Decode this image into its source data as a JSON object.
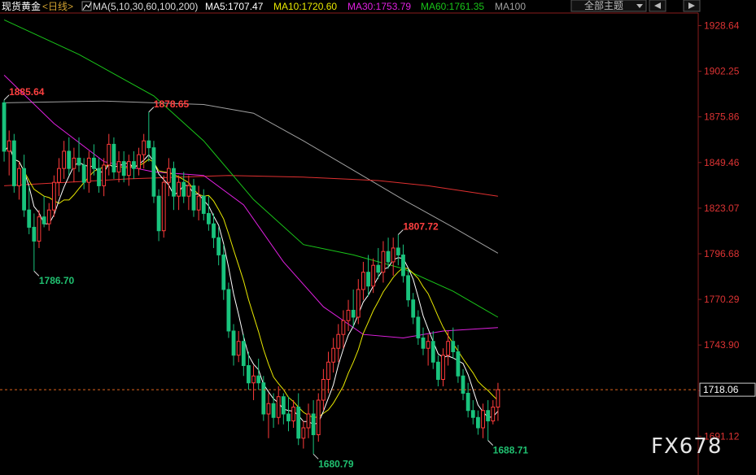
{
  "header": {
    "symbol": "现货黄金",
    "period": "<日线>",
    "ma_params": "MA(5,10,30,60,100,200)",
    "ma5": "MA5:1707.47",
    "ma10": "MA10:1720.60",
    "ma30": "MA30:1753.79",
    "ma60": "MA60:1761.35",
    "ma100": "MA100",
    "theme_button": "全部主题",
    "prev_icon": "prev-arrow-icon",
    "next_icon": "next-arrow-icon"
  },
  "watermark": "FX678",
  "colors": {
    "up": "#ff3b3b",
    "down": "#19c37d",
    "ma5": "#ffffff",
    "ma10": "#e8e800",
    "ma30": "#e020e0",
    "ma60": "#19c519",
    "ma100": "#a0a0a0",
    "ma200": "#e03030",
    "axis_text": "#d33333",
    "current_line": "#e0661e"
  },
  "chart_data": {
    "type": "candlestick",
    "ylim": [
      1680,
      1935
    ],
    "y_ticks": [
      "1928.64",
      "1902.25",
      "1875.86",
      "1849.46",
      "1823.07",
      "1796.68",
      "1770.29",
      "1743.90",
      "1717.51",
      "1691.12"
    ],
    "current_price": "1718.06",
    "annotations": [
      {
        "label": "1885.64",
        "value": 1885.64,
        "bar": 0,
        "kind": "high"
      },
      {
        "label": "1786.70",
        "value": 1786.7,
        "bar": 6,
        "kind": "low"
      },
      {
        "label": "1878.65",
        "value": 1878.65,
        "bar": 29,
        "kind": "high"
      },
      {
        "label": "1680.79",
        "value": 1680.79,
        "bar": 62,
        "kind": "low"
      },
      {
        "label": "1807.72",
        "value": 1807.72,
        "bar": 79,
        "kind": "high"
      },
      {
        "label": "1688.71",
        "value": 1688.71,
        "bar": 97,
        "kind": "low"
      }
    ],
    "candles_ohlc": [
      [
        1884,
        1885.64,
        1850,
        1856
      ],
      [
        1856,
        1868,
        1842,
        1862
      ],
      [
        1862,
        1866,
        1832,
        1836
      ],
      [
        1836,
        1850,
        1828,
        1846
      ],
      [
        1846,
        1854,
        1818,
        1822
      ],
      [
        1822,
        1836,
        1808,
        1812
      ],
      [
        1812,
        1820,
        1786.7,
        1804
      ],
      [
        1804,
        1822,
        1800,
        1818
      ],
      [
        1818,
        1830,
        1812,
        1814
      ],
      [
        1814,
        1826,
        1810,
        1822
      ],
      [
        1822,
        1842,
        1818,
        1838
      ],
      [
        1838,
        1852,
        1830,
        1846
      ],
      [
        1846,
        1862,
        1840,
        1856
      ],
      [
        1856,
        1864,
        1842,
        1846
      ],
      [
        1846,
        1858,
        1838,
        1852
      ],
      [
        1852,
        1864,
        1844,
        1848
      ],
      [
        1848,
        1852,
        1834,
        1838
      ],
      [
        1838,
        1856,
        1832,
        1852
      ],
      [
        1852,
        1860,
        1842,
        1846
      ],
      [
        1846,
        1852,
        1832,
        1836
      ],
      [
        1836,
        1852,
        1830,
        1848
      ],
      [
        1848,
        1866,
        1842,
        1860
      ],
      [
        1860,
        1864,
        1840,
        1844
      ],
      [
        1844,
        1856,
        1838,
        1850
      ],
      [
        1850,
        1856,
        1838,
        1842
      ],
      [
        1842,
        1854,
        1836,
        1850
      ],
      [
        1850,
        1856,
        1840,
        1846
      ],
      [
        1846,
        1858,
        1842,
        1854
      ],
      [
        1854,
        1866,
        1846,
        1862
      ],
      [
        1862,
        1878.65,
        1850,
        1858
      ],
      [
        1858,
        1862,
        1826,
        1830
      ],
      [
        1830,
        1834,
        1804,
        1810
      ],
      [
        1810,
        1842,
        1806,
        1838
      ],
      [
        1838,
        1852,
        1830,
        1846
      ],
      [
        1846,
        1850,
        1822,
        1830
      ],
      [
        1830,
        1842,
        1822,
        1838
      ],
      [
        1838,
        1844,
        1826,
        1830
      ],
      [
        1830,
        1842,
        1822,
        1836
      ],
      [
        1836,
        1840,
        1818,
        1822
      ],
      [
        1822,
        1836,
        1816,
        1830
      ],
      [
        1830,
        1834,
        1816,
        1820
      ],
      [
        1820,
        1830,
        1810,
        1814
      ],
      [
        1814,
        1820,
        1800,
        1806
      ],
      [
        1806,
        1812,
        1790,
        1796
      ],
      [
        1796,
        1802,
        1770,
        1776
      ],
      [
        1776,
        1780,
        1748,
        1752
      ],
      [
        1752,
        1756,
        1732,
        1738
      ],
      [
        1738,
        1752,
        1734,
        1746
      ],
      [
        1746,
        1750,
        1726,
        1732
      ],
      [
        1732,
        1740,
        1718,
        1722
      ],
      [
        1722,
        1732,
        1712,
        1726
      ],
      [
        1726,
        1736,
        1718,
        1722
      ],
      [
        1722,
        1726,
        1700,
        1704
      ],
      [
        1704,
        1716,
        1690,
        1710
      ],
      [
        1710,
        1716,
        1696,
        1702
      ],
      [
        1702,
        1720,
        1698,
        1714
      ],
      [
        1714,
        1716,
        1698,
        1704
      ],
      [
        1704,
        1714,
        1694,
        1700
      ],
      [
        1700,
        1712,
        1696,
        1708
      ],
      [
        1708,
        1716,
        1686,
        1690
      ],
      [
        1690,
        1700,
        1684,
        1696
      ],
      [
        1696,
        1710,
        1690,
        1704
      ],
      [
        1704,
        1712,
        1680.79,
        1692
      ],
      [
        1692,
        1716,
        1688,
        1712
      ],
      [
        1712,
        1730,
        1706,
        1724
      ],
      [
        1724,
        1740,
        1716,
        1734
      ],
      [
        1734,
        1748,
        1728,
        1742
      ],
      [
        1742,
        1756,
        1734,
        1750
      ],
      [
        1750,
        1764,
        1742,
        1758
      ],
      [
        1758,
        1770,
        1752,
        1764
      ],
      [
        1764,
        1776,
        1754,
        1760
      ],
      [
        1760,
        1782,
        1756,
        1776
      ],
      [
        1776,
        1792,
        1770,
        1786
      ],
      [
        1786,
        1796,
        1772,
        1778
      ],
      [
        1778,
        1794,
        1774,
        1790
      ],
      [
        1790,
        1800,
        1782,
        1786
      ],
      [
        1786,
        1804,
        1780,
        1798
      ],
      [
        1798,
        1806,
        1788,
        1792
      ],
      [
        1792,
        1806,
        1784,
        1800
      ],
      [
        1800,
        1807.72,
        1790,
        1796
      ],
      [
        1796,
        1802,
        1780,
        1784
      ],
      [
        1784,
        1788,
        1766,
        1770
      ],
      [
        1770,
        1774,
        1756,
        1760
      ],
      [
        1760,
        1764,
        1744,
        1748
      ],
      [
        1748,
        1754,
        1738,
        1742
      ],
      [
        1742,
        1750,
        1732,
        1746
      ],
      [
        1746,
        1752,
        1730,
        1734
      ],
      [
        1734,
        1738,
        1720,
        1724
      ],
      [
        1724,
        1742,
        1720,
        1738
      ],
      [
        1738,
        1752,
        1732,
        1746
      ],
      [
        1746,
        1754,
        1736,
        1740
      ],
      [
        1740,
        1744,
        1722,
        1726
      ],
      [
        1726,
        1730,
        1712,
        1716
      ],
      [
        1716,
        1722,
        1702,
        1706
      ],
      [
        1706,
        1712,
        1698,
        1702
      ],
      [
        1702,
        1706,
        1692,
        1696
      ],
      [
        1696,
        1710,
        1690,
        1706
      ],
      [
        1706,
        1712,
        1688.71,
        1700
      ],
      [
        1700,
        1712,
        1698,
        1708
      ],
      [
        1708,
        1722,
        1700,
        1718.06
      ]
    ],
    "series": [
      {
        "name": "MA100",
        "x": [
          0,
          20,
          40,
          50,
          60,
          70,
          80,
          90,
          99
        ],
        "values": [
          1884,
          1885,
          1883,
          1878,
          1862,
          1845,
          1828,
          1812,
          1797
        ]
      },
      {
        "name": "MA200",
        "x": [
          0,
          25,
          45,
          60,
          75,
          85,
          99
        ],
        "values": [
          1836,
          1840,
          1842,
          1841,
          1839,
          1836,
          1830
        ]
      },
      {
        "name": "MA60",
        "x": [
          0,
          15,
          30,
          40,
          50,
          60,
          70,
          80,
          90,
          99
        ],
        "values": [
          1932,
          1912,
          1888,
          1862,
          1828,
          1802,
          1796,
          1788,
          1775,
          1760
        ]
      },
      {
        "name": "MA30",
        "x": [
          0,
          10,
          20,
          30,
          40,
          48,
          56,
          64,
          72,
          80,
          88,
          99
        ],
        "values": [
          1900,
          1872,
          1850,
          1844,
          1842,
          1825,
          1792,
          1766,
          1750,
          1748,
          1752,
          1754
        ]
      }
    ]
  }
}
